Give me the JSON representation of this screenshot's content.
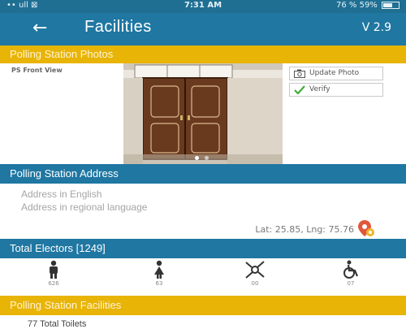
{
  "status_bar": {
    "left": "•• ull ⊠",
    "time": "7:31 AM",
    "right": "76 % 59%",
    "battery_level": 0.59
  },
  "header": {
    "title": "Facilities",
    "version": "V 2.9"
  },
  "photos_section": {
    "title": "Polling Station Photos",
    "caption": "PS Front View",
    "update_label": "Update Photo",
    "verify_label": "Verify",
    "carousel_dots": 2
  },
  "address_section": {
    "title": "Polling Station Address",
    "english": "Address in English",
    "regional": "Address in regional language",
    "latlng": "Lat: 25.85, Lng: 75.76"
  },
  "electors_section": {
    "title": "Total Electors [1249]",
    "groups": [
      {
        "icon": "male-icon",
        "count": "626"
      },
      {
        "icon": "female-icon",
        "count": "63"
      },
      {
        "icon": "third-gender-icon",
        "count": "00"
      },
      {
        "icon": "wheelchair-icon",
        "count": "07"
      }
    ]
  },
  "facilities_section": {
    "title": "Polling Station Facilities",
    "first_item": "77 Total Toilets"
  },
  "colors": {
    "primary": "#1f77a2",
    "accent": "#e8b406",
    "pin": "#e2573b"
  }
}
